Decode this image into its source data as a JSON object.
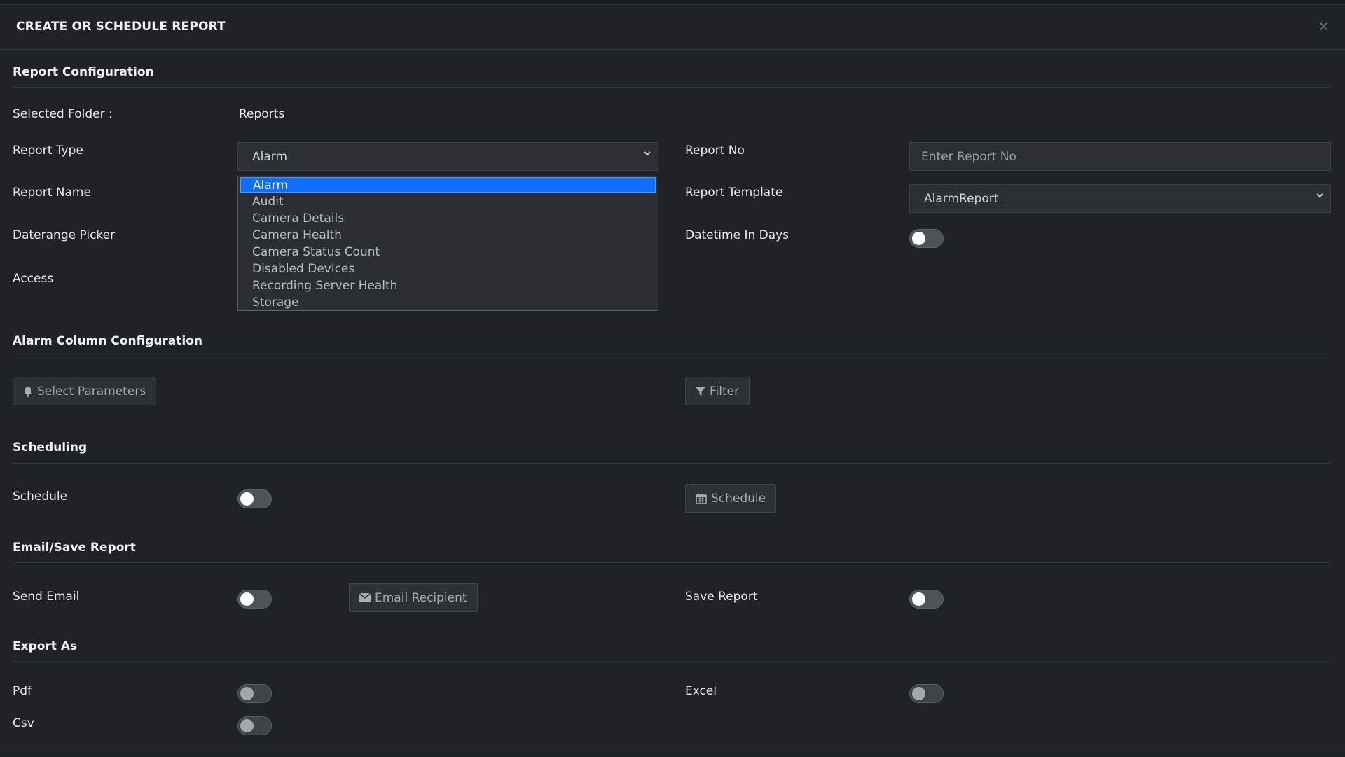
{
  "dialog": {
    "title": "CREATE OR SCHEDULE REPORT",
    "close_label": "×"
  },
  "report_config": {
    "section_title": "Report Configuration",
    "selected_folder_label": "Selected Folder :",
    "selected_folder_value": "Reports",
    "report_type_label": "Report Type",
    "report_type_value": "Alarm",
    "report_type_options": [
      "Alarm",
      "Audit",
      "Camera Details",
      "Camera Health",
      "Camera Status Count",
      "Disabled Devices",
      "Recording Server Health",
      "Storage"
    ],
    "report_name_label": "Report Name",
    "daterange_label": "Daterange Picker",
    "access_label": "Access",
    "report_no_label": "Report No",
    "report_no_placeholder": "Enter Report No",
    "report_template_label": "Report Template",
    "report_template_value": "AlarmReport",
    "datetime_days_label": "Datetime In Days"
  },
  "column_config": {
    "section_title": "Alarm Column Configuration",
    "select_params_label": "Select Parameters",
    "filter_label": "Filter"
  },
  "scheduling": {
    "section_title": "Scheduling",
    "schedule_label": "Schedule",
    "schedule_button": "Schedule"
  },
  "email_save": {
    "section_title": "Email/Save Report",
    "send_email_label": "Send Email",
    "email_recipient_button": "Email Recipient",
    "save_report_label": "Save Report"
  },
  "export": {
    "section_title": "Export As",
    "pdf_label": "Pdf",
    "csv_label": "Csv",
    "excel_label": "Excel"
  },
  "colors": {
    "accent": "#0d6efd",
    "background": "#1f2327",
    "field": "#2c3034"
  },
  "icons": [
    "bell-icon",
    "filter-icon",
    "calendar-icon",
    "envelope-icon",
    "chevron-down-icon",
    "close-icon"
  ]
}
